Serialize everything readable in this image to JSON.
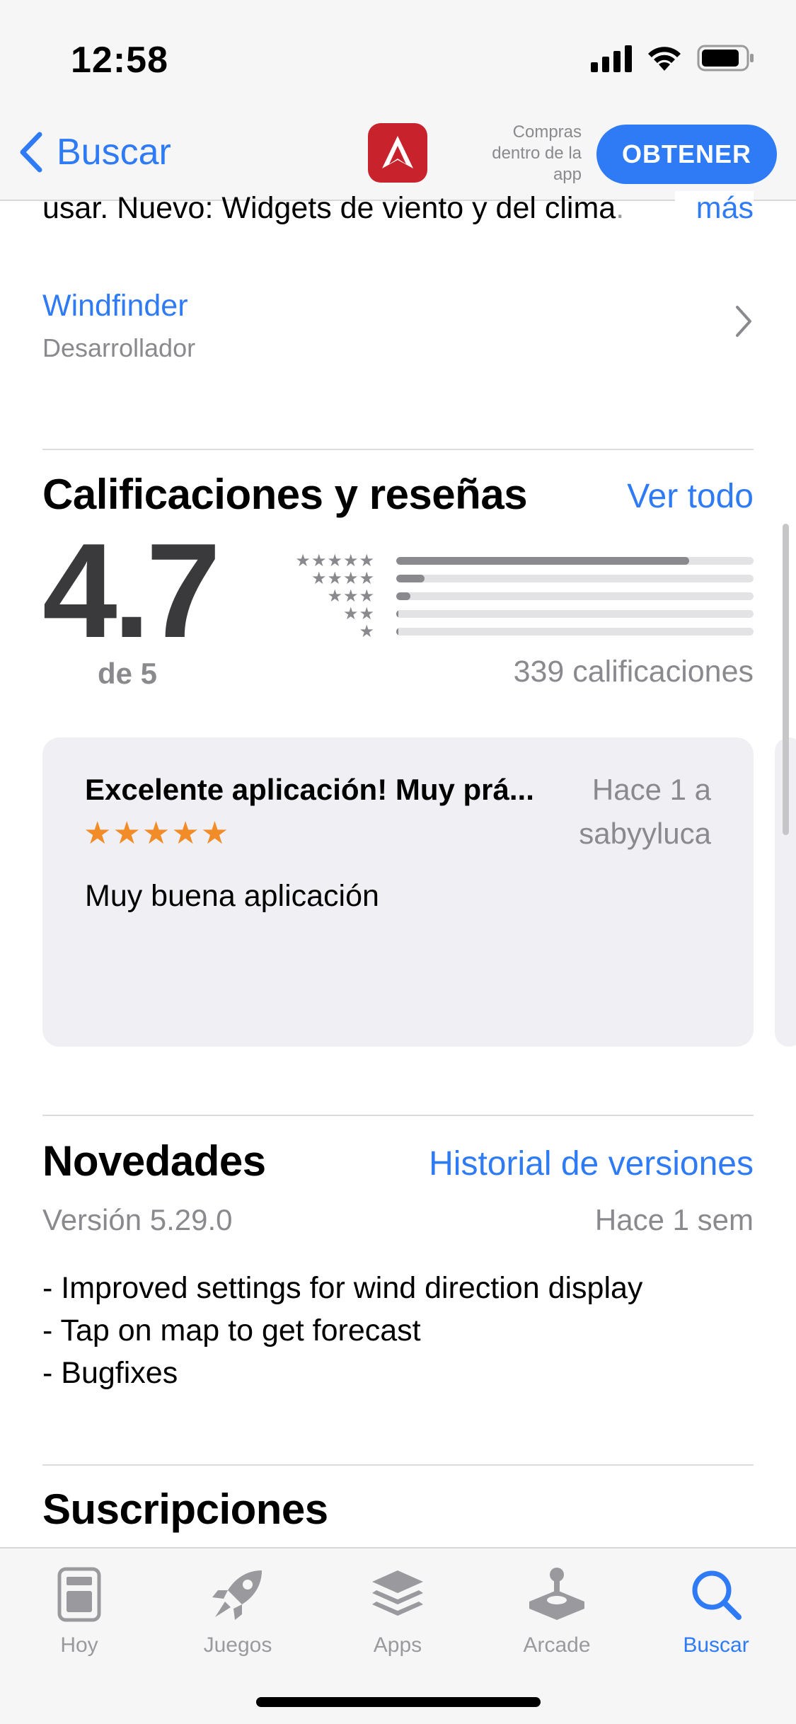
{
  "status_bar": {
    "time": "12:58"
  },
  "nav": {
    "back_label": "Buscar",
    "iap_note": [
      "Compras",
      "dentro de la",
      "app"
    ],
    "get_label": "OBTENER",
    "accent": "#2f7bf5"
  },
  "description": {
    "text": "usar. Nuevo: Widgets de viento y del clima",
    "fade_text": ".",
    "more_label": "más"
  },
  "developer": {
    "name": "Windfinder",
    "role": "Desarrollador"
  },
  "ratings": {
    "title": "Calificaciones y reseñas",
    "see_all": "Ver todo",
    "average": "4.7",
    "out_of": "de 5",
    "count_label": "339 calificaciones",
    "distribution": [
      {
        "stars": "★★★★★",
        "fraction": 0.82
      },
      {
        "stars": "★★★★",
        "fraction": 0.08
      },
      {
        "stars": "★★★",
        "fraction": 0.04
      },
      {
        "stars": "★★",
        "fraction": 0.005
      },
      {
        "stars": "★",
        "fraction": 0.005
      }
    ]
  },
  "review": {
    "title": "Excelente aplicación! Muy prá...",
    "date": "Hace 1 a",
    "stars": "★★★★★",
    "rating": 5,
    "author": "sabyyluca",
    "body": "Muy buena aplicación",
    "star_color": "#f28c28"
  },
  "whats_new": {
    "title": "Novedades",
    "history_link": "Historial de versiones",
    "version": "Versión 5.29.0",
    "date": "Hace 1 sem",
    "notes": [
      "- Improved settings for wind direction display",
      "- Tap on map to get forecast",
      "- Bugfixes"
    ]
  },
  "subscriptions": {
    "title": "Suscripciones"
  },
  "tabbar": {
    "tabs": [
      {
        "label": "Hoy",
        "icon": "today-icon",
        "active": false
      },
      {
        "label": "Juegos",
        "icon": "rocket-icon",
        "active": false
      },
      {
        "label": "Apps",
        "icon": "layers-icon",
        "active": false
      },
      {
        "label": "Arcade",
        "icon": "joystick-icon",
        "active": false
      },
      {
        "label": "Buscar",
        "icon": "search-icon",
        "active": true
      }
    ]
  }
}
